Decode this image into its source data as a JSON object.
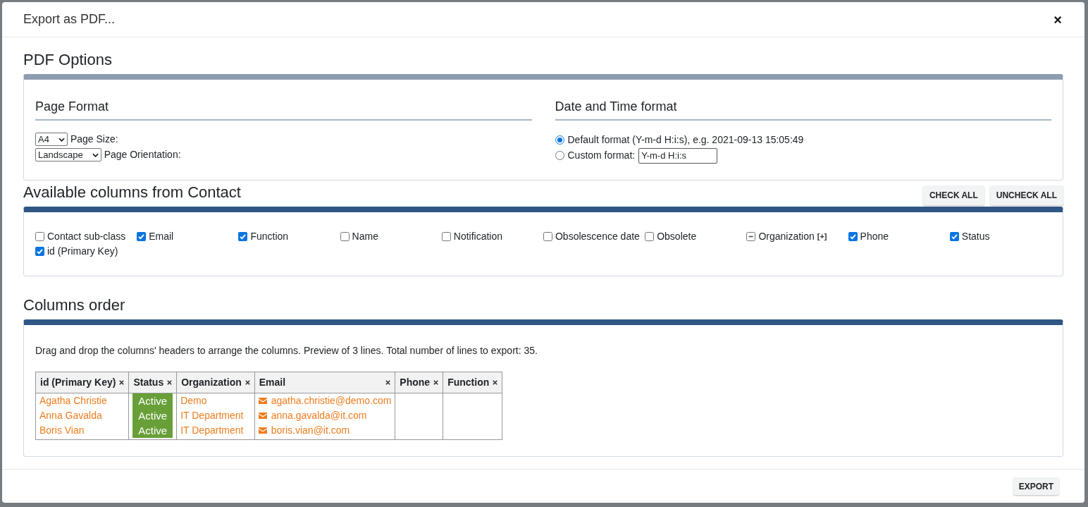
{
  "dialog": {
    "title": "Export as PDF...",
    "close_label": "×"
  },
  "pdf_options": {
    "heading": "PDF Options",
    "page_format": {
      "heading": "Page Format",
      "rows": [
        {
          "select": "A4",
          "caption": "Page Size:"
        },
        {
          "select": "Landscape",
          "caption": "Page Orientation:"
        }
      ]
    },
    "date_time_format": {
      "heading": "Date and Time format",
      "options": [
        {
          "label": "Default format (Y-m-d H:i:s), e.g. 2021-09-13 15:05:49",
          "selected": true
        },
        {
          "label": "Custom format:",
          "selected": false,
          "value": "Y-m-d H:i:s"
        }
      ]
    }
  },
  "available_columns": {
    "heading": "Available columns from Contact",
    "buttons": [
      "CHECK ALL",
      "UNCHECK ALL"
    ],
    "items": [
      {
        "label": "Contact sub-class",
        "checked": false,
        "indeterminate": false
      },
      {
        "label": "Email",
        "checked": true,
        "indeterminate": false
      },
      {
        "label": "Function",
        "checked": true,
        "indeterminate": false
      },
      {
        "label": "Name",
        "checked": false,
        "indeterminate": false
      },
      {
        "label": "Notification",
        "checked": false,
        "indeterminate": false
      },
      {
        "label": "Obsolescence date",
        "checked": false,
        "indeterminate": false
      },
      {
        "label": "Obsolete",
        "checked": false,
        "indeterminate": false
      },
      {
        "label": "Organization",
        "checked": false,
        "indeterminate": true,
        "expand_label": "[+]"
      },
      {
        "label": "Phone",
        "checked": true,
        "indeterminate": false
      },
      {
        "label": "Status",
        "checked": true,
        "indeterminate": false
      },
      {
        "label": "id (Primary Key)",
        "checked": true,
        "indeterminate": false
      }
    ]
  },
  "columns_order": {
    "heading": "Columns order",
    "instructions": "Drag and drop the columns' headers to arrange the columns. Preview of 3 lines. Total number of lines to export: 35.",
    "table": {
      "columns": [
        {
          "label": "id (Primary Key)",
          "kind": "link"
        },
        {
          "label": "Status",
          "kind": "badge"
        },
        {
          "label": "Organization",
          "kind": "link"
        },
        {
          "label": "Email",
          "kind": "email"
        },
        {
          "label": "Phone",
          "kind": "text"
        },
        {
          "label": "Function",
          "kind": "text"
        }
      ],
      "rows": [
        {
          "cells": [
            "Agatha Christie",
            "Active",
            "Demo",
            "agatha.christie@demo.com"
          ]
        },
        {
          "cells": [
            "Anna Gavalda",
            "Active",
            "IT Department",
            "anna.gavalda@it.com"
          ]
        },
        {
          "cells": [
            "Boris Vian",
            "Active",
            "IT Department",
            "boris.vian@it.com"
          ]
        }
      ]
    }
  },
  "footer": {
    "buttons": [
      "EXPORT"
    ]
  }
}
